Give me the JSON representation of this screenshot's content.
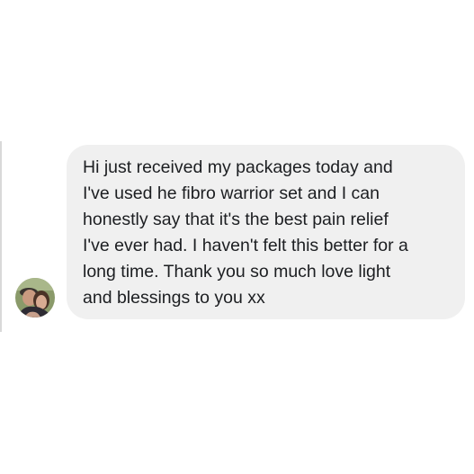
{
  "conversation": {
    "messages": [
      {
        "text": "Hi just received my packages today and\nI've used he fibro warrior set and I can\nhonestly say that it's the best pain relief\nI've ever had. I haven't felt this better for a\nlong time. Thank you so much love light\nand blessings to you xx",
        "avatar_icon": "user-photo-avatar"
      }
    ]
  },
  "colors": {
    "bubble_background": "#f0f0f0",
    "text": "#1c1e21",
    "page_background": "#ffffff"
  }
}
